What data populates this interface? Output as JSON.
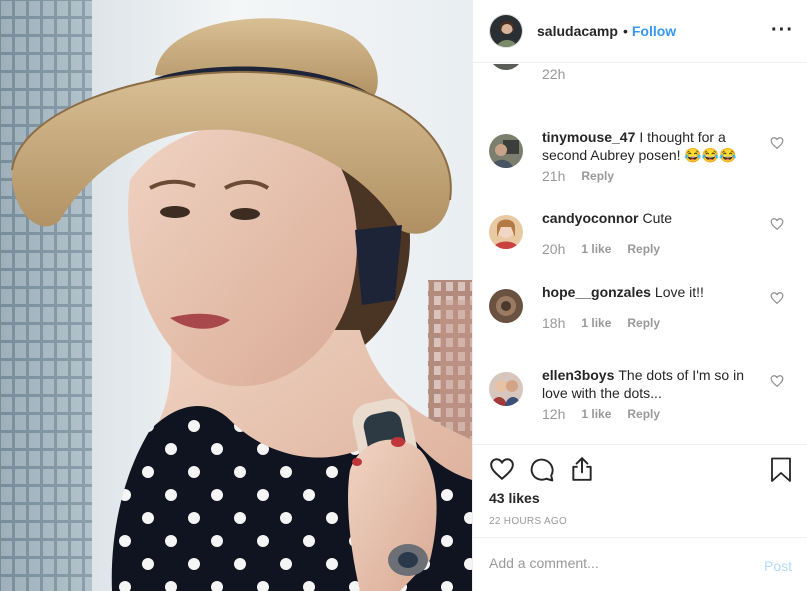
{
  "post": {
    "username": "saludacamp",
    "separator": "•",
    "follow_label": "Follow",
    "more_label": "···"
  },
  "comments": {
    "partial_time": "22h",
    "items": [
      {
        "username": "tinymouse_47",
        "text": "I thought for a second Aubrey posen! 😂😂😂",
        "time": "21h",
        "likes": "",
        "reply_label": "Reply"
      },
      {
        "username": "candyoconnor",
        "text": "Cute",
        "time": "20h",
        "likes": "1 like",
        "reply_label": "Reply"
      },
      {
        "username": "hope__gonzales",
        "text": "Love it!!",
        "time": "18h",
        "likes": "1 like",
        "reply_label": "Reply"
      },
      {
        "username": "ellen3boys",
        "text": "The dots of I'm so in love with the dots...",
        "time": "12h",
        "likes": "1 like",
        "reply_label": "Reply"
      }
    ]
  },
  "actions": {
    "like_icon": "heart-icon",
    "comment_icon": "comment-icon",
    "share_icon": "share-icon",
    "save_icon": "bookmark-icon",
    "likes_count": "43 likes",
    "post_time": "22 HOURS AGO"
  },
  "add_comment": {
    "placeholder": "Add a comment...",
    "post_label": "Post"
  },
  "colors": {
    "link": "#3897f0",
    "muted": "#999999",
    "text": "#262626",
    "border": "#efefef",
    "post_disabled": "#b3dbff"
  }
}
